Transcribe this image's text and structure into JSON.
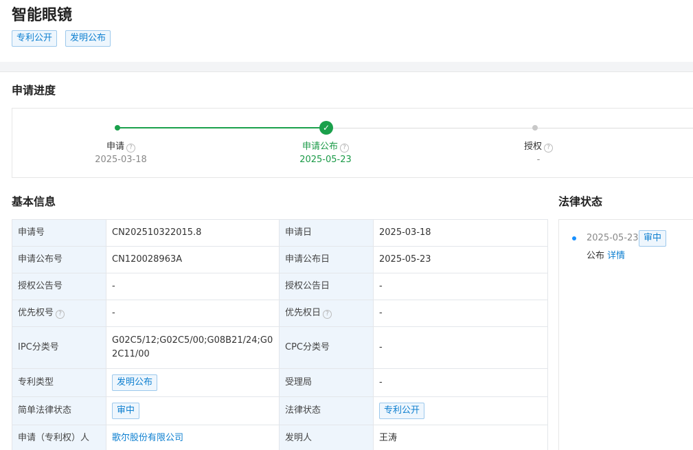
{
  "header": {
    "title": "智能眼镜",
    "tags": [
      "专利公开",
      "发明公布"
    ]
  },
  "progress": {
    "section_title": "申请进度",
    "steps": [
      {
        "label": "申请",
        "date": "2025-03-18"
      },
      {
        "label": "申请公布",
        "date": "2025-05-23"
      },
      {
        "label": "授权",
        "date": "-"
      }
    ]
  },
  "basic": {
    "section_title": "基本信息",
    "rows": [
      {
        "l1": "申请号",
        "v1": "CN202510322015.8",
        "l2": "申请日",
        "v2": "2025-03-18"
      },
      {
        "l1": "申请公布号",
        "v1": "CN120028963A",
        "l2": "申请公布日",
        "v2": "2025-05-23"
      },
      {
        "l1": "授权公告号",
        "v1": "-",
        "l2": "授权公告日",
        "v2": "-"
      },
      {
        "l1": "优先权号",
        "v1": "-",
        "l2": "优先权日",
        "v2": "-"
      },
      {
        "l1": "IPC分类号",
        "v1": "G02C5/12;G02C5/00;G08B21/24;G02C11/00",
        "l2": "CPC分类号",
        "v2": "-"
      },
      {
        "l1": "专利类型",
        "v1": "发明公布",
        "l2": "受理局",
        "v2": "-"
      },
      {
        "l1": "简单法律状态",
        "v1": "审中",
        "l2": "法律状态",
        "v2": "专利公开"
      },
      {
        "l1": "申请（专利权）人",
        "v1": "歌尔股份有限公司",
        "l2": "发明人",
        "v2": "王涛"
      }
    ]
  },
  "legal": {
    "section_title": "法律状态",
    "date": "2025-05-23",
    "status_tag": "审中",
    "event": "公布",
    "detail_link": "详情"
  },
  "icons": {
    "help": "help-circle-icon",
    "check": "check-icon"
  },
  "colors": {
    "accent": "#0d7fd0",
    "success": "#1aa04b",
    "label_bg": "#eef5fc"
  }
}
